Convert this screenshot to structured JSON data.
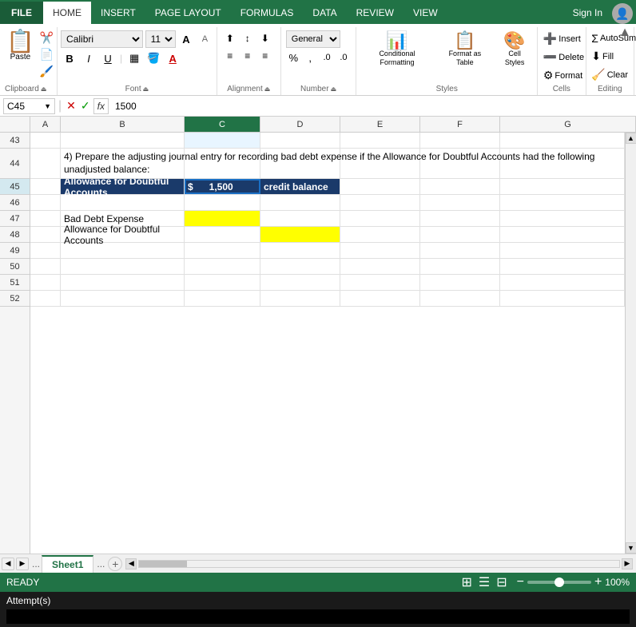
{
  "app": {
    "tabs": [
      "FILE",
      "HOME",
      "INSERT",
      "PAGE LAYOUT",
      "FORMULAS",
      "DATA",
      "REVIEW",
      "VIEW"
    ],
    "active_tab": "HOME",
    "sign_in": "Sign In"
  },
  "ribbon": {
    "clipboard_label": "Clipboard",
    "font_label": "Font",
    "alignment_label": "Alignment",
    "number_label": "Number",
    "styles_label": "Styles",
    "cells_label": "Cells",
    "editing_label": "Editing",
    "paste_label": "Paste",
    "font_name": "Calibri",
    "font_size": "11",
    "bold": "B",
    "italic": "I",
    "underline": "U",
    "conditional_formatting": "Conditional Formatting",
    "format_as_table": "Format as Table",
    "cell_styles": "Cell Styles",
    "cells_btn": "Cells",
    "editing_btn": "Editing"
  },
  "formula_bar": {
    "cell_ref": "C45",
    "formula": "1500",
    "cancel_label": "✕",
    "confirm_label": "✓",
    "fx_label": "fx"
  },
  "columns": [
    "A",
    "B",
    "C",
    "D",
    "E",
    "F",
    "G"
  ],
  "rows": [
    {
      "num": "43",
      "cells": [
        "",
        "",
        "",
        "",
        "",
        "",
        ""
      ]
    },
    {
      "num": "44",
      "cells": [
        "4) Prepare the adjusting journal entry for recording bad debt expense if the Allowance for Doubtful Accounts had the following unadjusted balance:",
        "",
        "",
        "",
        "",
        "",
        ""
      ]
    },
    {
      "num": "45",
      "cells": [
        "",
        "Allowance for Doubtful Accounts",
        "$        1,500",
        "credit balance",
        "",
        "",
        ""
      ]
    },
    {
      "num": "46",
      "cells": [
        "",
        "",
        "",
        "",
        "",
        "",
        ""
      ]
    },
    {
      "num": "47",
      "cells": [
        "",
        "Bad Debt Expense",
        "",
        "",
        "",
        "",
        ""
      ]
    },
    {
      "num": "48",
      "cells": [
        "",
        "Allowance for Doubtful Accounts",
        "",
        "",
        "",
        "",
        ""
      ]
    },
    {
      "num": "49",
      "cells": [
        "",
        "",
        "",
        "",
        "",
        "",
        ""
      ]
    },
    {
      "num": "50",
      "cells": [
        "",
        "",
        "",
        "",
        "",
        "",
        ""
      ]
    },
    {
      "num": "51",
      "cells": [
        "",
        "",
        "",
        "",
        "",
        "",
        ""
      ]
    },
    {
      "num": "52",
      "cells": [
        "",
        "",
        "",
        "",
        "",
        "",
        ""
      ]
    }
  ],
  "sheet_tabs": [
    "Sheet1"
  ],
  "status": {
    "ready": "READY",
    "zoom": "100%"
  },
  "attempts": {
    "label": "Attempt(s)"
  }
}
